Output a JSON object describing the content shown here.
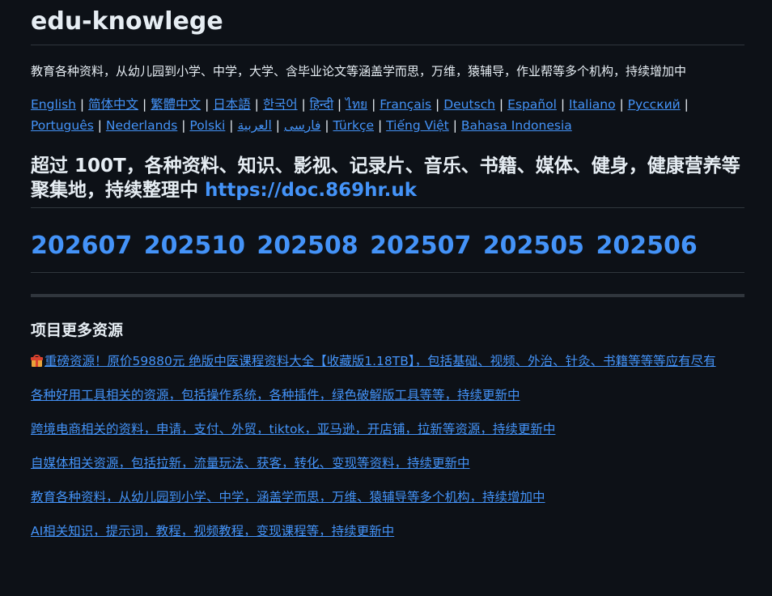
{
  "title": "edu-knowlege",
  "intro": "教育各种资料，从幼儿园到小学、中学，大学、含毕业论文等涵盖学而思，万维，猿辅导，作业帮等多个机构，持续增加中",
  "languages": [
    "English",
    "简体中文",
    "繁體中文",
    "日本語",
    "한국어",
    "हिन्दी",
    "ไทย",
    "Français",
    "Deutsch",
    "Español",
    "Italiano",
    "Русский",
    "Português",
    "Nederlands",
    "Polski",
    "فارسی",
    "العربية",
    "Türkçe",
    "Tiếng Việt",
    "Bahasa Indonesia"
  ],
  "headline": {
    "text": "超过 100T，各种资料、知识、影视、记录片、音乐、书籍、媒体、健身，健康营养等聚集地，持续整理中 ",
    "link": "https://doc.869hr.uk"
  },
  "years": [
    "202607",
    "202510",
    "202508",
    "202507",
    "202505",
    "202506"
  ],
  "section_title": "项目更多资源",
  "resources": [
    {
      "icon": "gift-icon",
      "text": "重磅资源！原价59880元 绝版中医课程资料大全【收藏版1.18TB】，包括基础、视频、外治、针灸、书籍等等等应有尽有"
    },
    {
      "text": "各种好用工具相关的资源，包括操作系统，各种插件，绿色破解版工具等等，持续更新中"
    },
    {
      "text": "跨境电商相关的资料，申请，支付、外贸，tiktok，亚马逊，开店铺，拉新等资源，持续更新中"
    },
    {
      "text": "自媒体相关资源，包括拉新，流量玩法、获客，转化、变现等资料，持续更新中"
    },
    {
      "text": "教育各种资料，从幼儿园到小学、中学，涵盖学而思，万维、猿辅导等多个机构，持续增加中"
    },
    {
      "text": "AI相关知识，提示词，教程，视频教程，变现课程等，持续更新中"
    }
  ],
  "colors": {
    "background": "#0d1117",
    "text": "#e6edf3",
    "link": "#4493f8",
    "divider": "#30363d"
  }
}
